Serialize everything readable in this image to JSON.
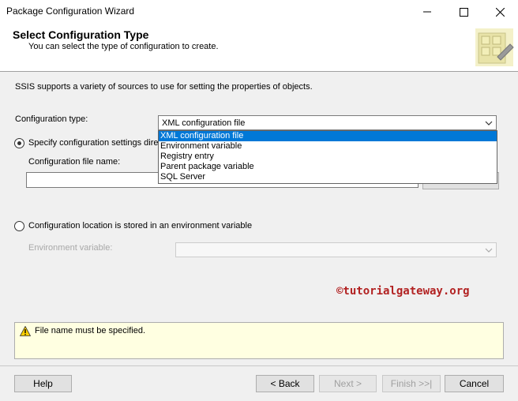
{
  "window": {
    "title": "Package Configuration Wizard",
    "minimize_icon": "minimize-icon",
    "maximize_icon": "maximize-icon",
    "close_icon": "close-icon"
  },
  "header": {
    "title": "Select Configuration Type",
    "subtitle": "You can select the type of configuration to create.",
    "banner_icon": "wizard-banner-icon"
  },
  "main": {
    "intro": "SSIS supports a variety of sources to use for setting the properties of objects.",
    "config_type_label": "Configuration type:",
    "config_type_value": "XML configuration file",
    "config_type_options": [
      "XML configuration file",
      "Environment variable",
      "Registry entry",
      "Parent package variable",
      "SQL Server"
    ],
    "radio_direct_label": "Specify configuration settings direct",
    "file_name_label": "Configuration file name:",
    "file_name_value": "",
    "browse_label": "Browse...",
    "radio_env_label": "Configuration location is stored in an environment variable",
    "env_var_label": "Environment variable:",
    "env_var_value": ""
  },
  "watermark": "©tutorialgateway.org",
  "message": {
    "icon": "warning-icon",
    "text": "File name must be specified."
  },
  "footer": {
    "help_label": "Help",
    "back_label": "< Back",
    "next_label": "Next >",
    "finish_label": "Finish >>|",
    "cancel_label": "Cancel"
  }
}
